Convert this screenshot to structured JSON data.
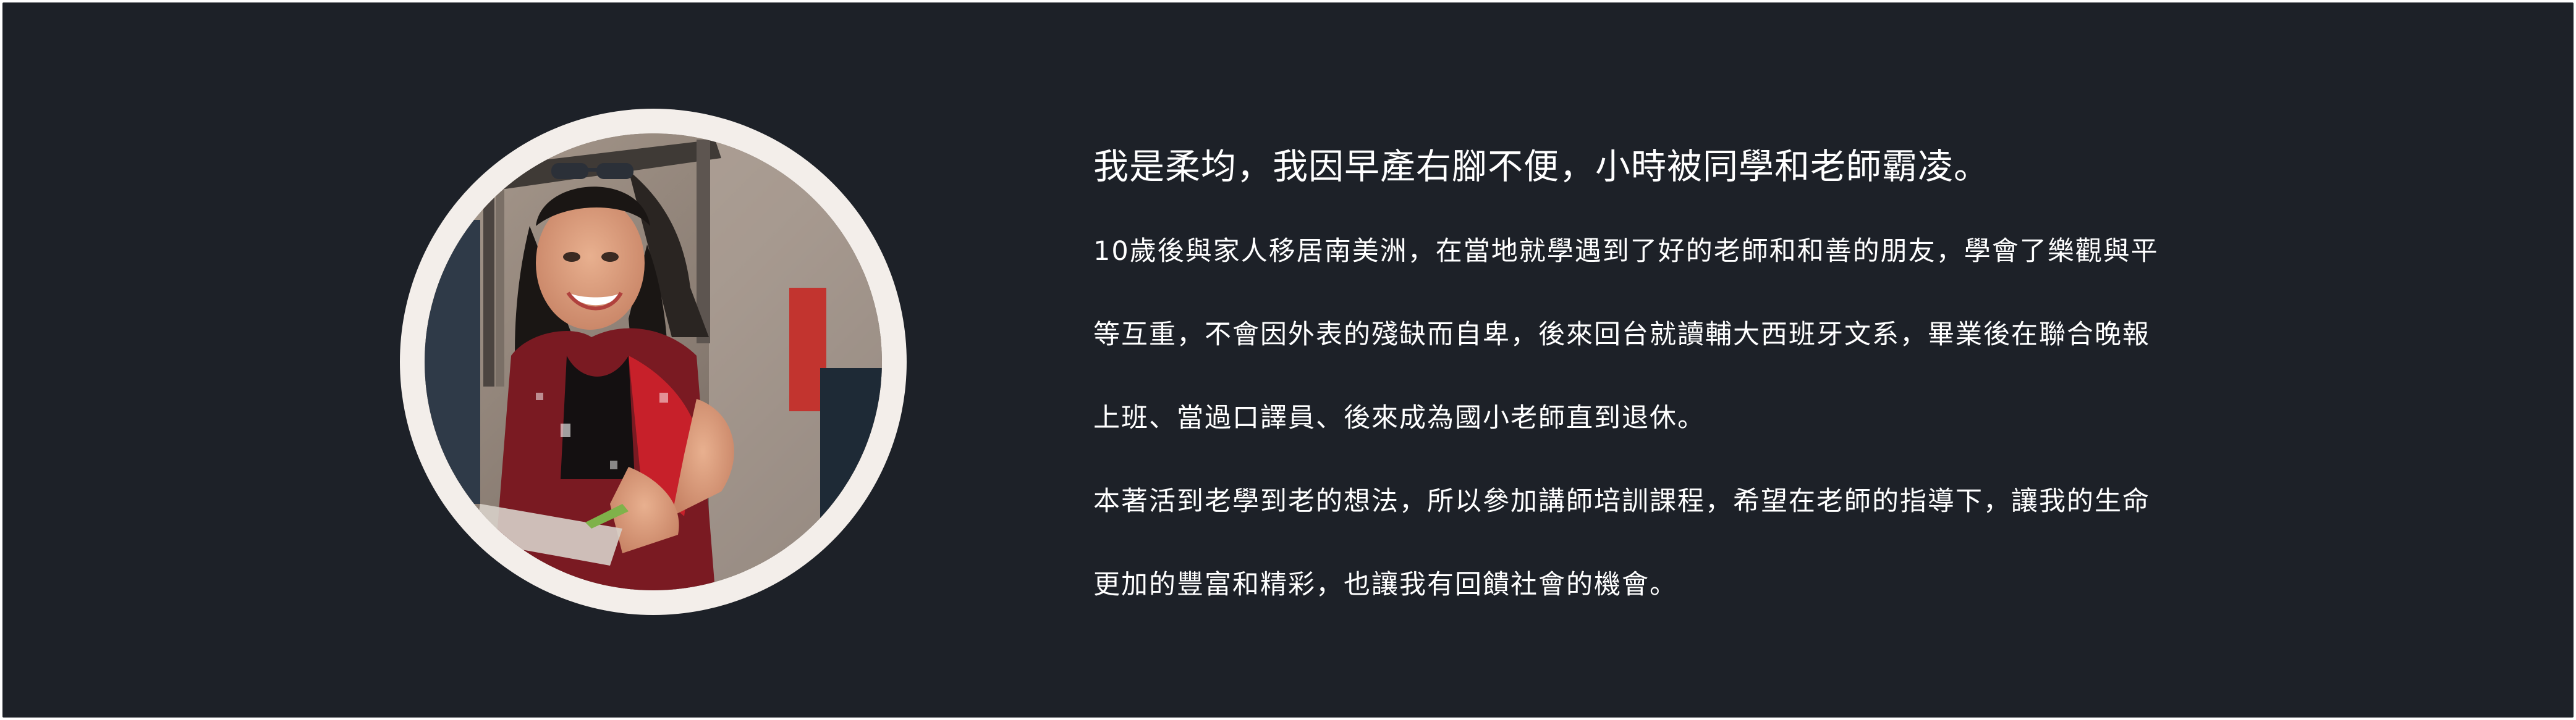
{
  "profile": {
    "avatar_alt": "profile-photo",
    "heading": "我是柔均，我因早產右腳不便，小時被同學和老師霸凌。",
    "paragraph_1": [
      "10歲後與家人移居南美洲，在當地就學遇到了好的老師和和善的朋友，學會了樂觀與平",
      "等互重，不會因外表的殘缺而自卑，後來回台就讀輔大西班牙文系，畢業後在聯合晚報",
      "上班、當過口譯員、後來成為國小老師直到退休。"
    ],
    "paragraph_2": [
      "本著活到老學到老的想法，所以參加講師培訓課程，希望在老師的指導下，讓我的生命",
      "更加的豐富和精彩，也讓我有回饋社會的機會。"
    ]
  },
  "colors": {
    "background": "#1d2128",
    "ring": "#f3eeea",
    "text": "#ffffff"
  }
}
